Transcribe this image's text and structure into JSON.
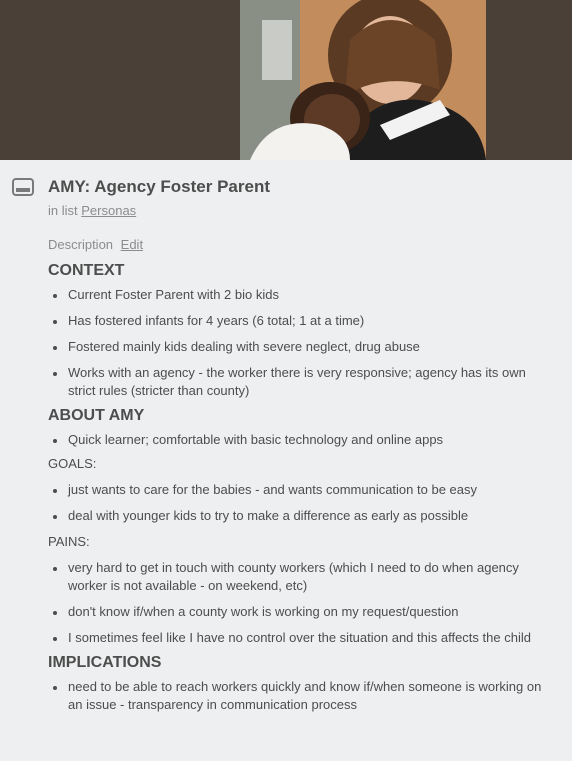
{
  "card": {
    "title": "AMY: Agency Foster Parent",
    "in_list_prefix": "in list",
    "list_name": "Personas",
    "description_label": "Description",
    "edit_label": "Edit"
  },
  "context": {
    "heading": "CONTEXT",
    "items": [
      "Current Foster Parent with 2 bio kids",
      "Has fostered infants for 4 years (6 total; 1 at a time)",
      "Fostered mainly kids dealing with severe neglect, drug abuse",
      "Works with an agency - the worker there is very responsive; agency has its own strict rules (stricter than county)"
    ]
  },
  "about": {
    "heading": "ABOUT AMY",
    "items": [
      "Quick learner; comfortable with basic technology and online apps"
    ]
  },
  "goals": {
    "label": "GOALS:",
    "items": [
      "just wants to care for the babies - and wants communication to be easy",
      "deal with younger kids to try to make a difference as early as possible"
    ]
  },
  "pains": {
    "label": "PAINS:",
    "items": [
      "very hard to get in touch with county workers (which I need to do when agency worker is not available - on weekend, etc)",
      "don't know if/when a county work is working on my request/question",
      "I sometimes feel like I have no control over the situation and this affects the child"
    ]
  },
  "implications": {
    "heading": "IMPLICATIONS",
    "items": [
      "need to be able to reach workers quickly and know if/when someone is working on an issue - transparency in communication process"
    ]
  },
  "icons": {
    "card_icon": "card-icon"
  },
  "colors": {
    "cover_background": "#4b4038",
    "panel_background": "#edeff0",
    "text": "#4d4d4d",
    "muted_text": "#8c8c8c"
  }
}
